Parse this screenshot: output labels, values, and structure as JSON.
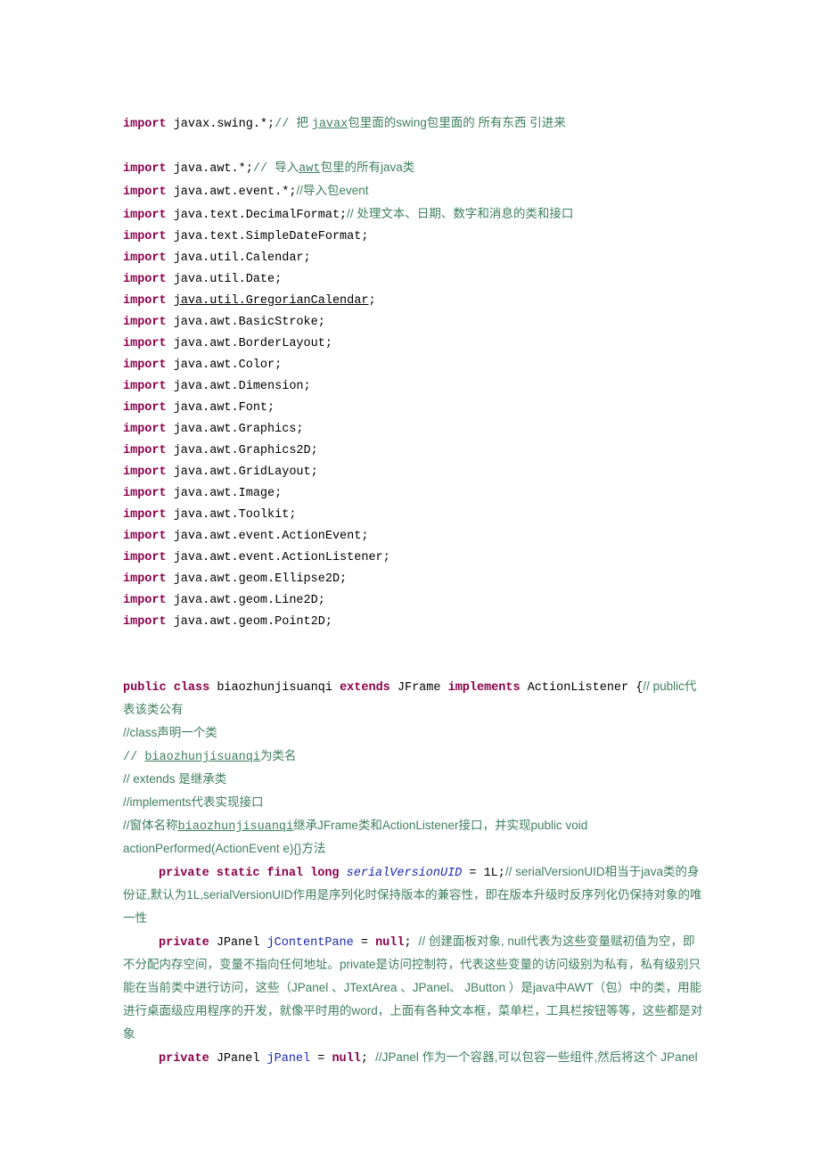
{
  "lines": {
    "l1_kw": "import",
    "l1_code": " javax.swing.*;",
    "l1_c1": "// ",
    "l1_c2": "把 ",
    "l1_link": "javax",
    "l1_c3": "包里面的swing包里面的 所有东西 引进来",
    "l2_kw": "import",
    "l2_code": " java.awt.*;",
    "l2_c1": "// ",
    "l2_c2": "导入",
    "l2_link": "awt",
    "l2_c3": "包里的所有java类",
    "l3_kw": "import",
    "l3_code": " java.awt.event.*;",
    "l3_c": "//导入包event",
    "l4_kw": "import",
    "l4_code": " java.text.DecimalFormat;",
    "l4_c": "// 处理文本、日期、数字和消息的类和接口",
    "l5_kw": "import",
    "l5_code": " java.text.SimpleDateFormat;",
    "l6_kw": "import",
    "l6_code": " java.util.Calendar;",
    "l7_kw": "import",
    "l7_code": " java.util.Date;",
    "l8_kw": "import",
    "l8_sp": " ",
    "l8_link": "java.util.GregorianCalendar",
    "l8_semi": ";",
    "l9_kw": "import",
    "l9_code": " java.awt.BasicStroke;",
    "l10_kw": "import",
    "l10_code": " java.awt.BorderLayout;",
    "l11_kw": "import",
    "l11_code": " java.awt.Color;",
    "l12_kw": "import",
    "l12_code": " java.awt.Dimension;",
    "l13_kw": "import",
    "l13_code": " java.awt.Font;",
    "l14_kw": "import",
    "l14_code": " java.awt.Graphics;",
    "l15_kw": "import",
    "l15_code": " java.awt.Graphics2D;",
    "l16_kw": "import",
    "l16_code": " java.awt.GridLayout;",
    "l17_kw": "import",
    "l17_code": " java.awt.Image;",
    "l18_kw": "import",
    "l18_code": " java.awt.Toolkit;",
    "l19_kw": "import",
    "l19_code": " java.awt.event.ActionEvent;",
    "l20_kw": "import",
    "l20_code": " java.awt.event.ActionListener;",
    "l21_kw": "import",
    "l21_code": " java.awt.geom.Ellipse2D;",
    "l22_kw": "import",
    "l22_code": " java.awt.geom.Line2D;",
    "l23_kw": "import",
    "l23_code": " java.awt.geom.Point2D;",
    "cls_kw1": "public",
    "cls_kw2": "class",
    "cls_name": " biaozhunjisuanqi ",
    "cls_kw3": "extends",
    "cls_mid": " JFrame ",
    "cls_kw4": "implements",
    "cls_tail": " ActionListener {",
    "cls_c": "// public代表该类公有",
    "c1": "//class声明一个类",
    "c2a": "// ",
    "c2link": "biaozhunjisuanqi",
    "c2b": "为类名",
    "c3": "// extends 是继承类",
    "c4": "//implements代表实现接口",
    "c5a": "//窗体名称",
    "c5link": "biaozhunjisuanqi",
    "c5b": "继承JFrame类和ActionListener接口，并实现public void actionPerformed(ActionEvent e){}方法",
    "f1_kw": "private static final long",
    "f1_sp": " ",
    "f1_name": "serialVersionUID",
    "f1_eq": " = 1L;",
    "f1_c": "// serialVersionUID相当于java类的身份证,默认为1L,serialVersionUID作用是序列化时保持版本的兼容性，即在版本升级时反序列化仍保持对象的唯一性",
    "f2_kw": "private",
    "f2_mid1": " JPanel ",
    "f2_name": "jContentPane",
    "f2_mid2": " = ",
    "f2_kw2": "null",
    "f2_semi": "; ",
    "f2_c": "// 创建面板对象, null代表为这些变量赋初值为空，即不分配内存空间，变量不指向任何地址。private是访问控制符，代表这些变量的访问级别为私有，私有级别只能在当前类中进行访问，这些（JPanel 、JTextArea 、JPanel、 JButton ）是java中AWT（包）中的类，用能进行桌面级应用程序的开发，就像平时用的word，上面有各种文本框，菜单栏，工具栏按钮等等，这些都是对象",
    "f3_kw": "private",
    "f3_mid1": " JPanel ",
    "f3_name": "jPanel",
    "f3_mid2": " = ",
    "f3_kw2": "null",
    "f3_semi": "; ",
    "f3_c": "//JPanel 作为一个容器,可以包容一些组件,然后将这个 JPanel"
  }
}
